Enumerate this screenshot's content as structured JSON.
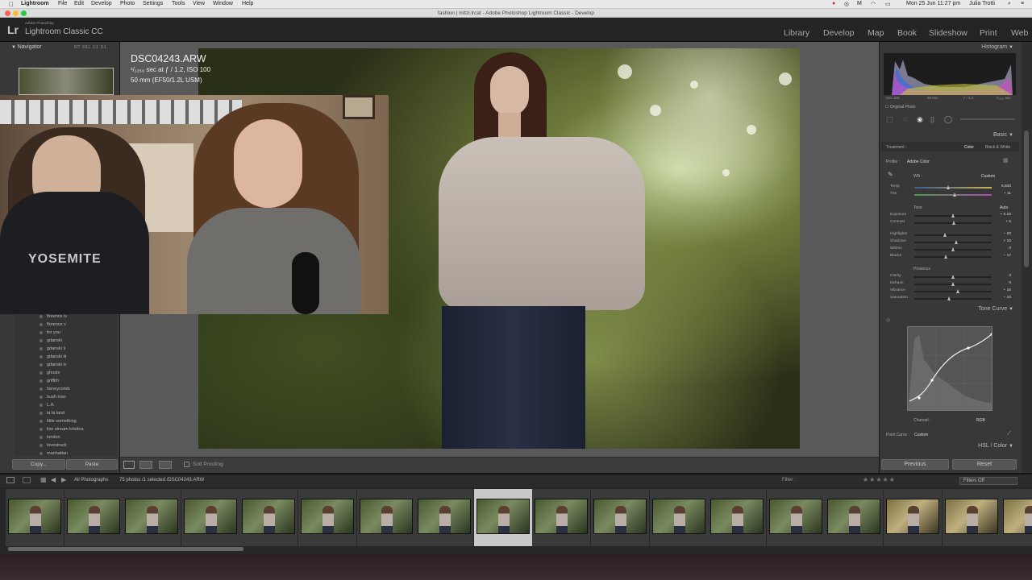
{
  "menubar": {
    "apple": "",
    "items": [
      "Lightroom",
      "File",
      "Edit",
      "Develop",
      "Photo",
      "Settings",
      "Tools",
      "View",
      "Window",
      "Help"
    ],
    "clock": "Mon 25 Jun  11:27 pm",
    "user": "Julia Trotti"
  },
  "window": {
    "title": "fashion | mitzi.lrcat - Adobe Photoshop Lightroom Classic - Develop"
  },
  "app": {
    "logo": "Lr",
    "logo_sub": "Adobe Photoshop",
    "name": "Lightroom Classic CC",
    "modules": [
      "Library",
      "Develop",
      "Map",
      "Book",
      "Slideshow",
      "Print",
      "Web"
    ],
    "active_module": "Develop"
  },
  "navigator": {
    "title": "Navigator",
    "zoom_options": [
      "FIT",
      "FILL",
      "1:1",
      "3:1"
    ]
  },
  "presets": [
    "florence iv",
    "florence v",
    "for you",
    "gdanski",
    "gdanski ii",
    "gdanski iii",
    "gdanski iv",
    "ghosts",
    "griffith",
    "honeycomb",
    "hush river",
    "L.A.",
    "la la land",
    "little something",
    "live stream kristina",
    "london",
    "lovestruck",
    "manhattan"
  ],
  "left_buttons": {
    "copy": "Copy...",
    "paste": "Paste"
  },
  "photo_info": {
    "filename": "DSC04243.ARW",
    "exposure": "¹/₁₂₅₀ sec at ƒ / 1.2, ISO 100",
    "lens": "50 mm (EF50/1.2L USM)"
  },
  "toolbar": {
    "soft_proofing": "Soft Proofing"
  },
  "histogram": {
    "title": "Histogram",
    "iso": "ISO 100",
    "focal": "50 mm",
    "aperture": "ƒ / 1.2",
    "shutter": "¹⁄₁₂₅₀ sec",
    "original_photo": "Original Photo"
  },
  "basic": {
    "title": "Basic",
    "treatment_label": "Treatment :",
    "treatment_color": "Color",
    "treatment_bw": "Black & White",
    "profile_label": "Profile :",
    "profile_value": "Adobe Color",
    "wb_label": "WB :",
    "wb_value": "Custom",
    "tone_label": "Tone",
    "tone_auto": "Auto",
    "presence_label": "Presence",
    "sliders": [
      {
        "label": "Temp",
        "value": "6,500",
        "pos": 0.44
      },
      {
        "label": "Tint",
        "value": "+ 11",
        "pos": 0.53
      },
      {
        "label": "Exposure",
        "value": "+ 0.10",
        "pos": 0.51
      },
      {
        "label": "Contrast",
        "value": "+ 5",
        "pos": 0.52
      },
      {
        "label": "Highlights",
        "value": "− 20",
        "pos": 0.4
      },
      {
        "label": "Shadows",
        "value": "+ 10",
        "pos": 0.55
      },
      {
        "label": "Whites",
        "value": "0",
        "pos": 0.5
      },
      {
        "label": "Blacks",
        "value": "− 17",
        "pos": 0.41
      },
      {
        "label": "Clarity",
        "value": "0",
        "pos": 0.5
      },
      {
        "label": "Dehaze",
        "value": "0",
        "pos": 0.5
      },
      {
        "label": "Vibrance",
        "value": "+ 15",
        "pos": 0.57
      },
      {
        "label": "Saturation",
        "value": "− 10",
        "pos": 0.45
      }
    ]
  },
  "tone_curve": {
    "title": "Tone Curve",
    "channel_label": "Channel :",
    "channel_value": "RGB",
    "point_curve_label": "Point Curve :",
    "point_curve_value": "Custom"
  },
  "hsl": {
    "title": "HSL / Color"
  },
  "right_buttons": {
    "previous": "Previous",
    "reset": "Reset"
  },
  "filmstrip": {
    "source": "All Photographs",
    "count": "75 photos /1 selected /DSC04243.ARW",
    "filter_label": "Filter :",
    "filters_off": "Filters Off",
    "selected_index": 8,
    "thumb_count": 18
  },
  "colors": {
    "accent": "#c9c9c9",
    "panel": "#383838",
    "center": "#595959"
  }
}
